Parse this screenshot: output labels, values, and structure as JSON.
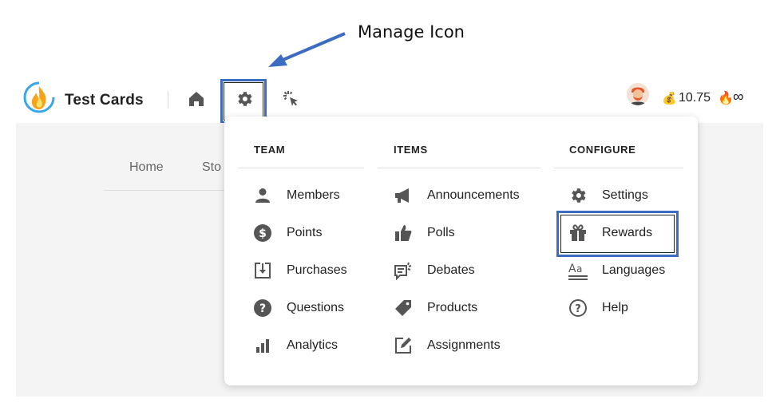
{
  "annotation": {
    "text": "Manage Icon",
    "color": "#3c6cc2"
  },
  "topbar": {
    "app_name": "Test Cards",
    "coins": "10.75",
    "streak": "∞",
    "icons": [
      "home-icon",
      "gear-icon",
      "cursor-click-icon"
    ]
  },
  "sub_nav": {
    "tabs": [
      "Home",
      "Sto"
    ]
  },
  "dropdown": {
    "columns": [
      {
        "header": "TEAM",
        "items": [
          {
            "label": "Members",
            "icon": "person-icon"
          },
          {
            "label": "Points",
            "icon": "dollar-circle-icon"
          },
          {
            "label": "Purchases",
            "icon": "download-tray-icon"
          },
          {
            "label": "Questions",
            "icon": "question-circle-icon"
          },
          {
            "label": "Analytics",
            "icon": "bar-chart-icon"
          }
        ]
      },
      {
        "header": "ITEMS",
        "items": [
          {
            "label": "Announcements",
            "icon": "megaphone-icon"
          },
          {
            "label": "Polls",
            "icon": "thumbs-up-icon"
          },
          {
            "label": "Debates",
            "icon": "debate-icon"
          },
          {
            "label": "Products",
            "icon": "tag-icon"
          },
          {
            "label": "Assignments",
            "icon": "edit-square-icon"
          }
        ]
      },
      {
        "header": "CONFIGURE",
        "items": [
          {
            "label": "Settings",
            "icon": "gear-icon"
          },
          {
            "label": "Rewards",
            "icon": "gift-icon"
          },
          {
            "label": "Languages",
            "icon": "language-icon"
          },
          {
            "label": "Help",
            "icon": "help-circle-icon"
          }
        ]
      }
    ]
  },
  "colors": {
    "highlight": "#3c6cc2",
    "icon": "#555555",
    "panel_bg": "#f4f4f4"
  }
}
